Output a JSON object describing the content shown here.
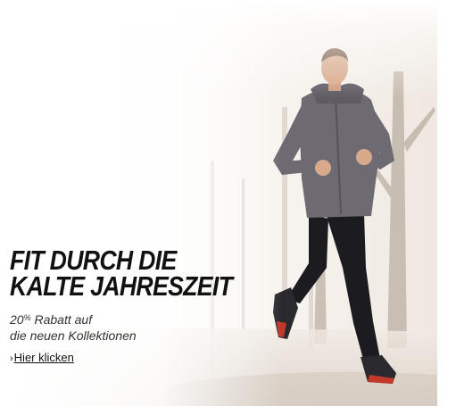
{
  "banner": {
    "headline_line1": "FIT DURCH DIE",
    "headline_line2": "KALTE JAHRESZEIT",
    "discount_number": "20",
    "discount_unit": "%",
    "discount_rest": " Rabatt auf",
    "subline_line2": "die neuen Kollektionen",
    "cta_chevron": "›",
    "cta_label": "Hier klicken"
  },
  "colors": {
    "headline": "#111111",
    "subtext": "#333333",
    "jacket": "#6e6a72",
    "tights": "#1c1b1f",
    "shoe_accent": "#c0392b"
  },
  "icons": {
    "cta": "chevron-right-icon"
  }
}
